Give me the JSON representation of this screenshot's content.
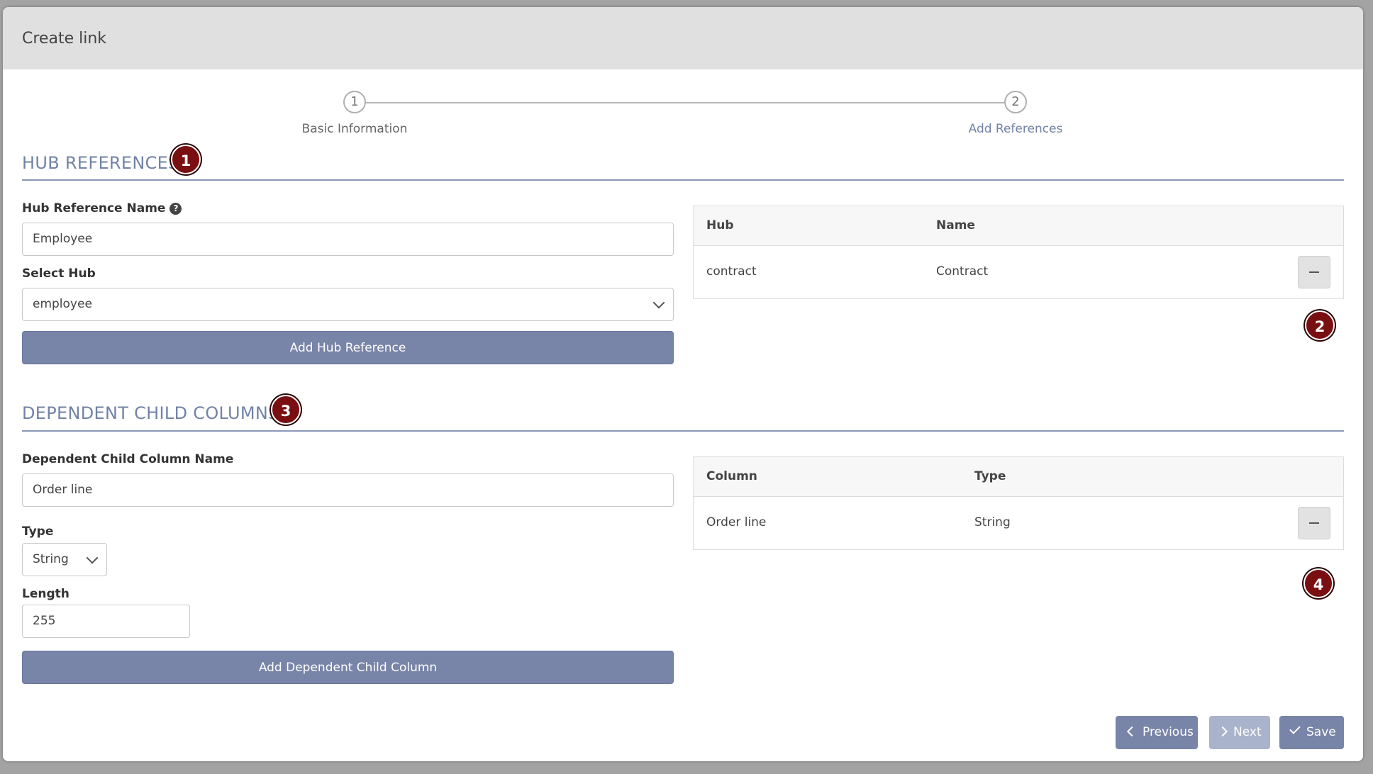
{
  "dialog": {
    "title": "Create link"
  },
  "stepper": {
    "steps": [
      {
        "number": "1",
        "label": "Basic Information"
      },
      {
        "number": "2",
        "label": "Add References"
      }
    ]
  },
  "hub_references": {
    "title": "HUB REFERENCES",
    "marker": "1",
    "name_label": "Hub Reference Name",
    "name_value": "Employee",
    "select_label": "Select Hub",
    "select_value": "employee",
    "add_button": "Add Hub Reference",
    "table": {
      "columns": [
        "Hub",
        "Name"
      ],
      "rows": [
        {
          "hub": "contract",
          "name": "Contract"
        }
      ]
    },
    "table_marker": "2"
  },
  "dependent_child_columns": {
    "title": "DEPENDENT CHILD COLUMNS",
    "marker": "3",
    "name_label": "Dependent Child Column Name",
    "name_value": "Order line",
    "type_label": "Type",
    "type_value": "String",
    "length_label": "Length",
    "length_value": "255",
    "add_button": "Add Dependent Child Column",
    "table": {
      "columns": [
        "Column",
        "Type"
      ],
      "rows": [
        {
          "column": "Order line",
          "type": "String"
        }
      ]
    },
    "table_marker": "4"
  },
  "footer": {
    "previous": "Previous",
    "next": "Next",
    "save": "Save"
  },
  "colors": {
    "accent": "#7183a6",
    "button": "#7884a8",
    "marker": "#7a0f12",
    "next_disabled": "#a9b3cc"
  }
}
